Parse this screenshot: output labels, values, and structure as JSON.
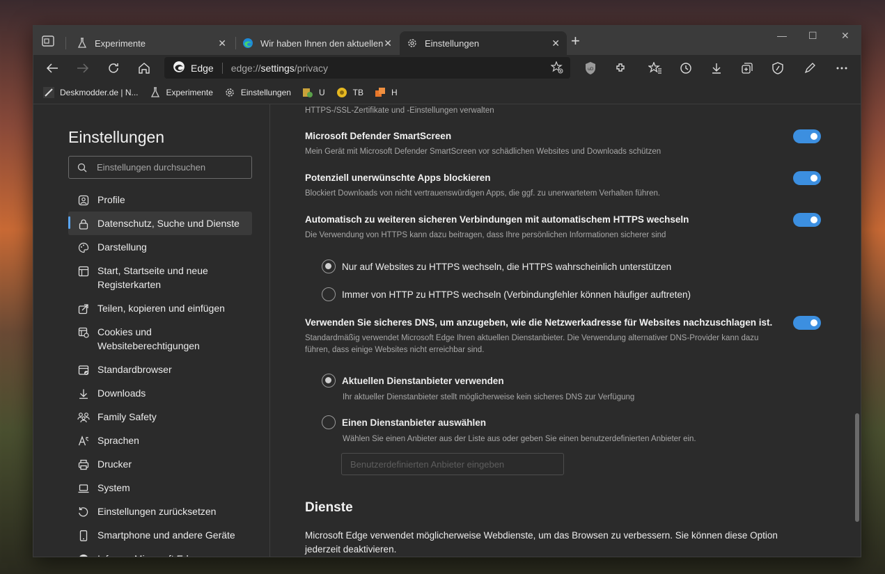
{
  "tabs": [
    {
      "label": "Experimente",
      "icon": "flask-icon"
    },
    {
      "label": "Wir haben Ihnen den aktuellen B",
      "icon": "edge-logo-icon"
    },
    {
      "label": "Einstellungen",
      "icon": "gear-icon"
    }
  ],
  "omnibox": {
    "brand": "Edge",
    "url_prefix": "edge://",
    "url_main": "settings",
    "url_suffix": "/privacy"
  },
  "bookmarks": [
    {
      "label": "Deskmodder.de | N...",
      "icon": "deskmodder-icon"
    },
    {
      "label": "Experimente",
      "icon": "flask-icon"
    },
    {
      "label": "Einstellungen",
      "icon": "gear-icon"
    },
    {
      "label": "U",
      "icon": "u-extension-icon"
    },
    {
      "label": "TB",
      "icon": "tb-coin-icon"
    },
    {
      "label": "H",
      "icon": "h-extension-icon"
    }
  ],
  "sidebar": {
    "title": "Einstellungen",
    "search_placeholder": "Einstellungen durchsuchen",
    "items": [
      {
        "label": "Profile",
        "icon": "profile-icon"
      },
      {
        "label": "Datenschutz, Suche und Dienste",
        "icon": "lock-icon",
        "active": true
      },
      {
        "label": "Darstellung",
        "icon": "palette-icon"
      },
      {
        "label": "Start, Startseite und neue Registerkarten",
        "icon": "home-grid-icon"
      },
      {
        "label": "Teilen, kopieren und einfügen",
        "icon": "share-icon"
      },
      {
        "label": "Cookies und Websiteberechtigungen",
        "icon": "cookie-grid-icon"
      },
      {
        "label": "Standardbrowser",
        "icon": "browser-icon"
      },
      {
        "label": "Downloads",
        "icon": "download-icon"
      },
      {
        "label": "Family Safety",
        "icon": "family-icon"
      },
      {
        "label": "Sprachen",
        "icon": "language-icon"
      },
      {
        "label": "Drucker",
        "icon": "printer-icon"
      },
      {
        "label": "System",
        "icon": "laptop-icon"
      },
      {
        "label": "Einstellungen zurücksetzen",
        "icon": "reset-icon"
      },
      {
        "label": "Smartphone und andere Geräte",
        "icon": "phone-icon"
      },
      {
        "label": "Infos zu Microsoft Edge",
        "icon": "edge-logo-icon"
      }
    ]
  },
  "main": {
    "top_desc": "HTTPS-/SSL-Zertifikate und -Einstellungen verwalten",
    "smartscreen": {
      "title": "Microsoft Defender SmartScreen",
      "desc": "Mein Gerät mit Microsoft Defender SmartScreen vor schädlichen Websites und Downloads schützen",
      "on": true
    },
    "pua": {
      "title": "Potenziell unerwünschte Apps blockieren",
      "desc": "Blockiert Downloads von nicht vertrauenswürdigen Apps, die ggf. zu unerwartetem Verhalten führen.",
      "on": true
    },
    "https": {
      "title": "Automatisch zu weiteren sicheren Verbindungen mit automatischem HTTPS wechseln",
      "desc": "Die Verwendung von HTTPS kann dazu beitragen, dass Ihre persönlichen Informationen sicherer sind",
      "on": true,
      "options": [
        {
          "label": "Nur auf Websites zu HTTPS wechseln, die HTTPS wahrscheinlich unterstützen",
          "selected": true
        },
        {
          "label": "Immer von HTTP zu HTTPS wechseln (Verbindungfehler können häufiger auftreten)",
          "selected": false
        }
      ]
    },
    "dns": {
      "title": "Verwenden Sie sicheres DNS, um anzugeben, wie die Netzwerkadresse für Websites nachzuschlagen ist.",
      "desc": "Standardmäßig verwendet Microsoft Edge Ihren aktuellen Dienstanbieter. Die Verwendung alternativer DNS-Provider kann dazu führen, dass einige Websites nicht erreichbar sind.",
      "on": true,
      "opt1_label": "Aktuellen Dienstanbieter verwenden",
      "opt1_desc": "Ihr aktueller Dienstanbieter stellt möglicherweise kein sicheres DNS zur Verfügung",
      "opt2_label": "Einen Dienstanbieter auswählen",
      "opt2_desc": "Wählen Sie einen Anbieter aus der Liste aus oder geben Sie einen benutzerdefinierten Anbieter ein.",
      "custom_placeholder": "Benutzerdefinierten Anbieter eingeben"
    },
    "services": {
      "heading": "Dienste",
      "desc": "Microsoft Edge verwendet möglicherweise Webdienste, um das Browsen zu verbessern. Sie können diese Option jederzeit deaktivieren."
    }
  },
  "colors": {
    "accent": "#3c8fe0",
    "bg": "#2b2b2b",
    "tab_strip": "#3b3b3b"
  }
}
